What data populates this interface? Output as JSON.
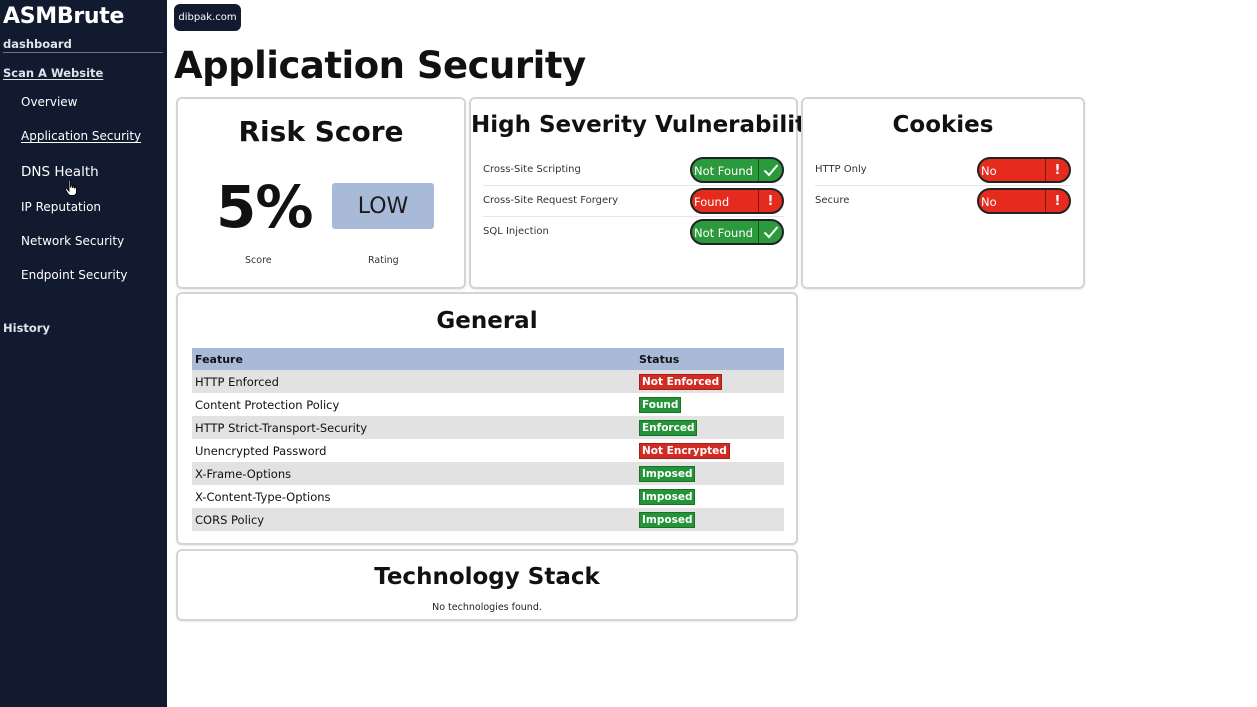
{
  "sidebar": {
    "brand": "ASMBrute",
    "section": "dashboard",
    "scan_link": "Scan A Website",
    "items": [
      {
        "label": "Overview"
      },
      {
        "label": "Application Security"
      },
      {
        "label": "DNS Health"
      },
      {
        "label": "IP Reputation"
      },
      {
        "label": "Network Security"
      },
      {
        "label": "Endpoint Security"
      }
    ],
    "history": "History"
  },
  "header": {
    "domain": "dibpak.com",
    "title": "Application Security"
  },
  "risk": {
    "title": "Risk Score",
    "score": "5%",
    "rating": "LOW",
    "score_caption": "Score",
    "rating_caption": "Rating"
  },
  "vulnerability": {
    "title": "High Severity Vulnerability",
    "rows": [
      {
        "label": "Cross-Site Scripting",
        "status": "Not Found",
        "state": "ok"
      },
      {
        "label": "Cross-Site Request Forgery",
        "status": "Found",
        "state": "bad"
      },
      {
        "label": "SQL Injection",
        "status": "Not Found",
        "state": "ok"
      }
    ]
  },
  "cookies": {
    "title": "Cookies",
    "rows": [
      {
        "label": "HTTP Only",
        "status": "No",
        "state": "bad"
      },
      {
        "label": "Secure",
        "status": "No",
        "state": "bad"
      }
    ]
  },
  "general": {
    "title": "General",
    "headers": [
      "Feature",
      "Status"
    ],
    "rows": [
      {
        "feature": "HTTP Enforced",
        "status": "Not Enforced",
        "state": "bad"
      },
      {
        "feature": "Content Protection Policy",
        "status": "Found",
        "state": "ok"
      },
      {
        "feature": "HTTP Strict-Transport-Security",
        "status": "Enforced",
        "state": "ok"
      },
      {
        "feature": "Unencrypted Password",
        "status": "Not Encrypted",
        "state": "bad"
      },
      {
        "feature": "X-Frame-Options",
        "status": "Imposed",
        "state": "ok"
      },
      {
        "feature": "X-Content-Type-Options",
        "status": "Imposed",
        "state": "ok"
      },
      {
        "feature": "CORS Policy",
        "status": "Imposed",
        "state": "ok"
      }
    ]
  },
  "tech_stack": {
    "title": "Technology Stack",
    "empty_text": "No technologies found."
  },
  "colors": {
    "sidebar_bg": "#111a2e",
    "ok_green": "#2b9a3d",
    "bad_red": "#e52a1e",
    "table_header": "#a9b9d8"
  }
}
